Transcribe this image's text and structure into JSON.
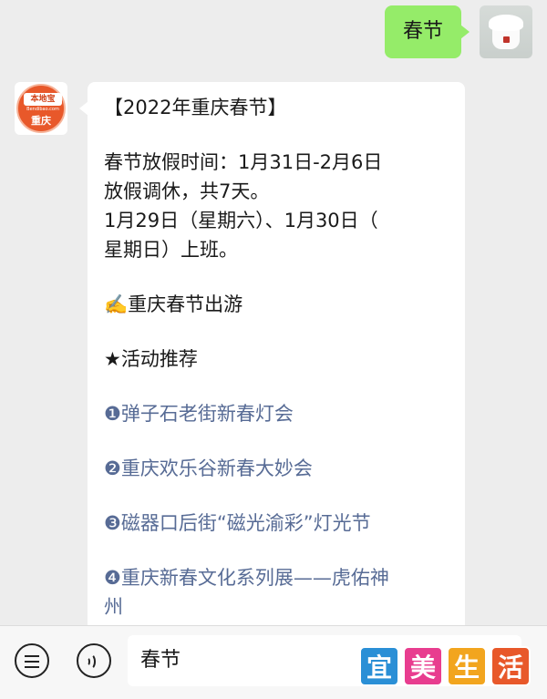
{
  "outgoing": {
    "text": "春节"
  },
  "incoming": {
    "lines": [
      "【2022年重庆春节】",
      "春节放假时间：1月31日-2月6日",
      "放假调休，共7天。",
      "1月29日（星期六）、1月30日（",
      "星期日）上班。",
      "✍️重庆春节出游",
      "★活动推荐",
      "❶弹子石老街新春灯会",
      "❷重庆欢乐谷新春大妙会",
      "❸磁器口后街“磁光渝彩”灯光节",
      "❹重庆新春文化系列展——虎佑神",
      "州"
    ]
  },
  "avatar_logo": {
    "top": "本地宝",
    "site": "Bendibao.com",
    "city": "重庆"
  },
  "input_bar": {
    "value": "春节"
  },
  "watermark": {
    "chars": [
      "宜",
      "美",
      "生",
      "活"
    ]
  },
  "colors": {
    "background": "#ededed",
    "outgoing_bubble": "#95ec69",
    "incoming_bubble": "#ffffff",
    "link": "#576b95",
    "logo": "#e8582a"
  },
  "icons": {
    "menu": "menu-icon",
    "voice": "voice-icon"
  }
}
